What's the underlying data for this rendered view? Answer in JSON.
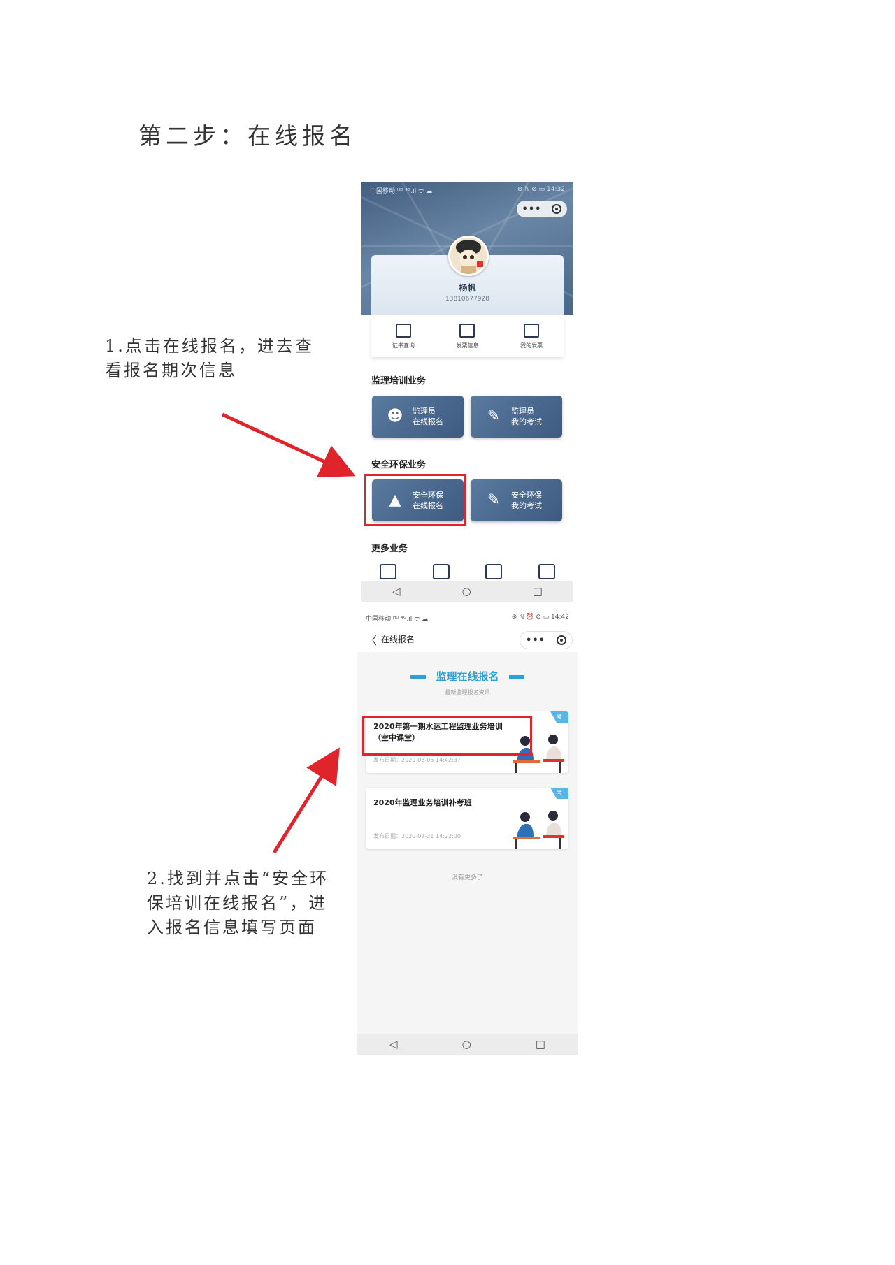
{
  "page": {
    "step_title": "第二步：在线报名",
    "note1": "1.点击在线报名，进去查看报名期次信息",
    "note2": "2.找到并点击“安全环保培训在线报名”，进入报名信息填写页面"
  },
  "phone1": {
    "status_left": "中国移动 ᴴᴰ ⁴ᴳ.ıl ᯤ ☁",
    "status_right": "⊛ ℕ ⊘ ▭ 14:32",
    "user_name": "杨帆",
    "user_phone": "13810677928",
    "quick_actions": [
      {
        "label": "证书查询",
        "icon": "certificate-icon"
      },
      {
        "label": "发票信息",
        "icon": "invoice-icon"
      },
      {
        "label": "我的发票",
        "icon": "my-invoice-icon"
      }
    ],
    "section1_title": "监理培训业务",
    "section2_title": "安全环保业务",
    "section3_title": "更多业务",
    "tiles": {
      "a_line1": "监理员",
      "a_line2": "在线报名",
      "b_line1": "监理员",
      "b_line2": "我的考试",
      "c_line1": "安全环保",
      "c_line2": "在线报名",
      "d_line1": "安全环保",
      "d_line2": "我的考试"
    },
    "nav": {
      "back": "◁",
      "home": "○",
      "recent": "□"
    }
  },
  "phone2": {
    "status_left": "中国移动 ᴴᴰ ⁴ᴳ.ıl ᯤ ☁",
    "status_right": "⊛ ℕ ⏰ ⊘ ▭ 14:42",
    "back": "〈",
    "title": "在线报名",
    "banner_title": "监理在线报名",
    "banner_sub": "最新监理报名资讯",
    "courses": [
      {
        "title": "2020年第一期水运工程监理业务培训（空中课堂）",
        "date": "发布日期：2020-03-05 14:42:37",
        "tag": "考"
      },
      {
        "title": "2020年监理业务培训补考班",
        "date": "发布日期：2020-07-31 14:22:00",
        "tag": "考"
      }
    ],
    "footer": "没有更多了",
    "nav": {
      "back": "◁",
      "home": "○",
      "recent": "□"
    }
  },
  "colors": {
    "highlight": "#e0242b",
    "tile_blue": "#4a6890",
    "accent_blue": "#2e9fd8"
  }
}
